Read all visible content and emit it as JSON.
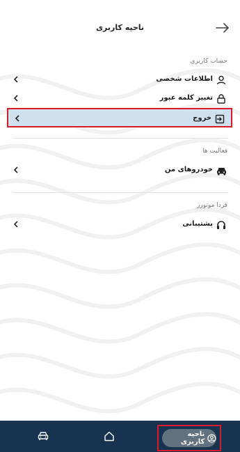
{
  "header": {
    "title": "ناحیه کاربری",
    "back_icon": "arrow-right-icon"
  },
  "sections": [
    {
      "title": "حساب کاربری",
      "items": [
        {
          "label": "اطلاعات شخصی",
          "icon": "user-icon"
        },
        {
          "label": "تغییر کلمه عبور",
          "icon": "lock-icon"
        },
        {
          "label": "خروج",
          "icon": "logout-icon",
          "selected": true
        }
      ]
    },
    {
      "title": "فعالیت ها",
      "items": [
        {
          "label": "خودروهای من",
          "icon": "car-icon"
        }
      ]
    },
    {
      "title": "فردا موتورز",
      "items": [
        {
          "label": "پشتیبانی",
          "icon": "headset-icon"
        }
      ]
    }
  ],
  "bottom_nav": {
    "items": [
      {
        "icon": "car-icon"
      },
      {
        "icon": "home-icon"
      },
      {
        "label": "ناحیه کاربری",
        "icon": "user-circle-icon",
        "active": true
      }
    ]
  },
  "colors": {
    "bottom_bar": "#17334f",
    "highlight_row": "#cfe0ef",
    "highlight_border": "#d9192c",
    "active_pill": "#62727f"
  }
}
